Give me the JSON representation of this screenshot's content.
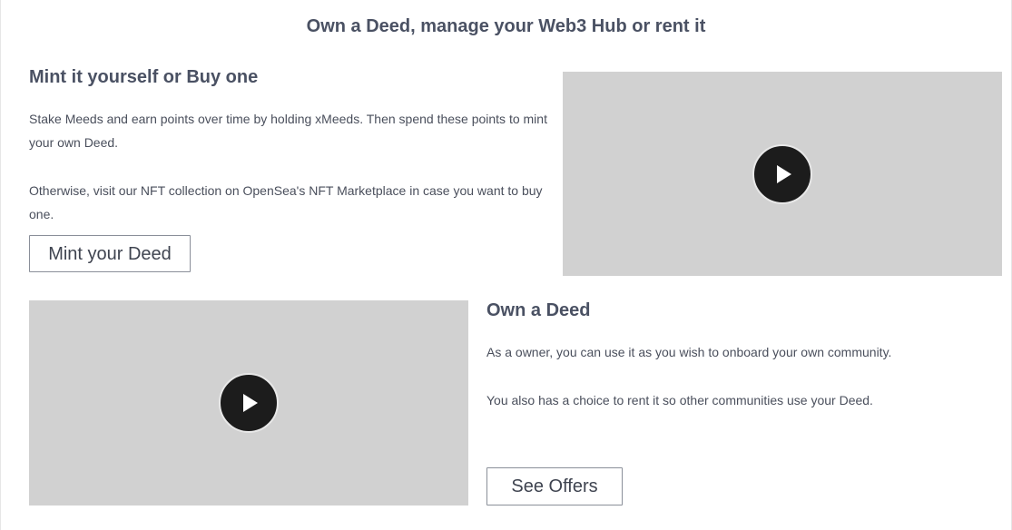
{
  "header": {
    "title": "Own a Deed, manage your Web3 Hub or rent it"
  },
  "mint_section": {
    "title": "Mint it yourself or Buy one",
    "paragraph1": "Stake Meeds and earn points over time by holding xMeeds. Then spend these points to mint your own Deed.",
    "paragraph2": "Otherwise, visit our NFT collection on OpenSea's NFT Marketplace in case you want to buy one.",
    "button_label": "Mint your Deed",
    "video_icon": "play-icon"
  },
  "own_section": {
    "title": "Own a Deed",
    "paragraph1": "As a owner, you can use it as you wish to onboard your own community.",
    "paragraph2": "You also has a choice to rent it so other communities use your Deed.",
    "button_label": "See Offers",
    "video_icon": "play-icon"
  },
  "colors": {
    "video_placeholder": "#d1d1d1",
    "play_button": "#1c1c1c",
    "heading_text": "#4a5163"
  }
}
